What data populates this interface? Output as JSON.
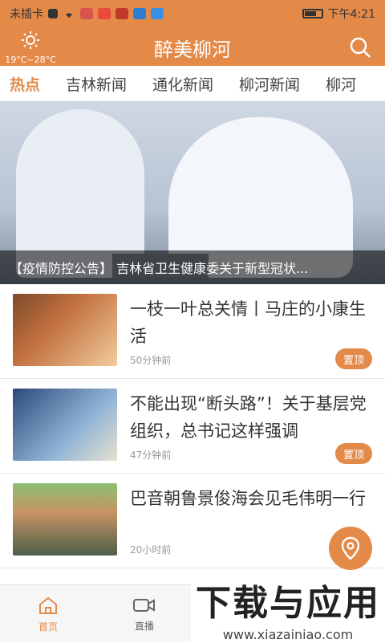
{
  "status_bar": {
    "carrier": "未插卡",
    "time": "下午4:21"
  },
  "header": {
    "title": "醉美柳河",
    "weather": "19°C~28°C"
  },
  "tabs": [
    {
      "label": "热点",
      "active": true
    },
    {
      "label": "吉林新闻",
      "active": false
    },
    {
      "label": "通化新闻",
      "active": false
    },
    {
      "label": "柳河新闻",
      "active": false
    },
    {
      "label": "柳河",
      "active": false
    }
  ],
  "banner": {
    "caption": "【疫情防控公告】 吉林省卫生健康委关于新型冠状..."
  },
  "news": [
    {
      "title": "一枝一叶总关情丨马庄的小康生活",
      "time": "50分钟前",
      "badge": "置顶"
    },
    {
      "title": "不能出现“断头路”！关于基层党组织，总书记这样强调",
      "time": "47分钟前",
      "badge": "置顶"
    },
    {
      "title": "巴音朝鲁景俊海会见毛伟明一行",
      "time": "20小时前",
      "badge": ""
    }
  ],
  "bottom_nav": {
    "home": "首页",
    "live": "直播"
  },
  "watermark": {
    "main": "下载与应用",
    "sub": "www.xiazainiao.com"
  },
  "colors": {
    "accent": "#e38a49"
  }
}
